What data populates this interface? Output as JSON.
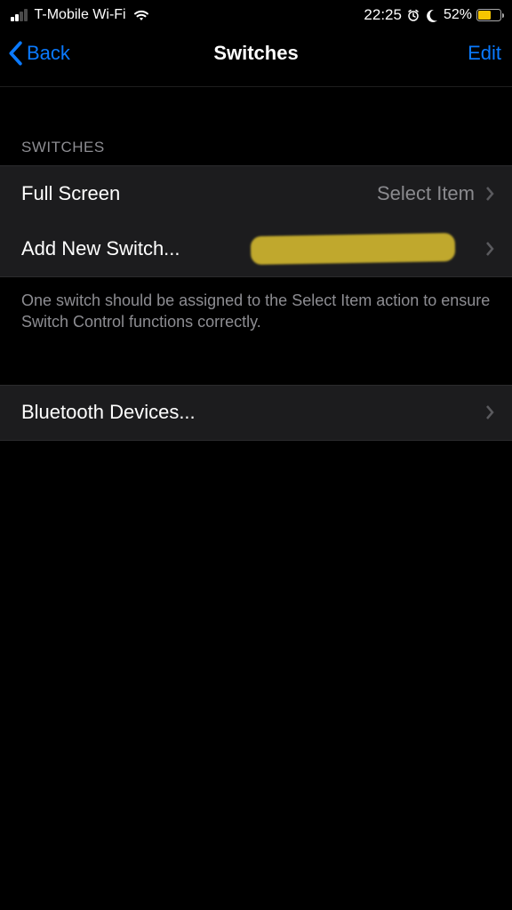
{
  "status": {
    "carrier": "T-Mobile Wi-Fi",
    "time": "22:25",
    "battery_pct": "52%"
  },
  "nav": {
    "back_label": "Back",
    "title": "Switches",
    "edit_label": "Edit"
  },
  "sections": {
    "switches": {
      "header": "Switches",
      "rows": [
        {
          "label": "Full Screen",
          "detail": "Select Item"
        },
        {
          "label": "Add New Switch...",
          "detail": ""
        }
      ],
      "footer": "One switch should be assigned to the Select Item action to ensure Switch Control functions correctly."
    },
    "bluetooth": {
      "rows": [
        {
          "label": "Bluetooth Devices...",
          "detail": ""
        }
      ]
    }
  }
}
